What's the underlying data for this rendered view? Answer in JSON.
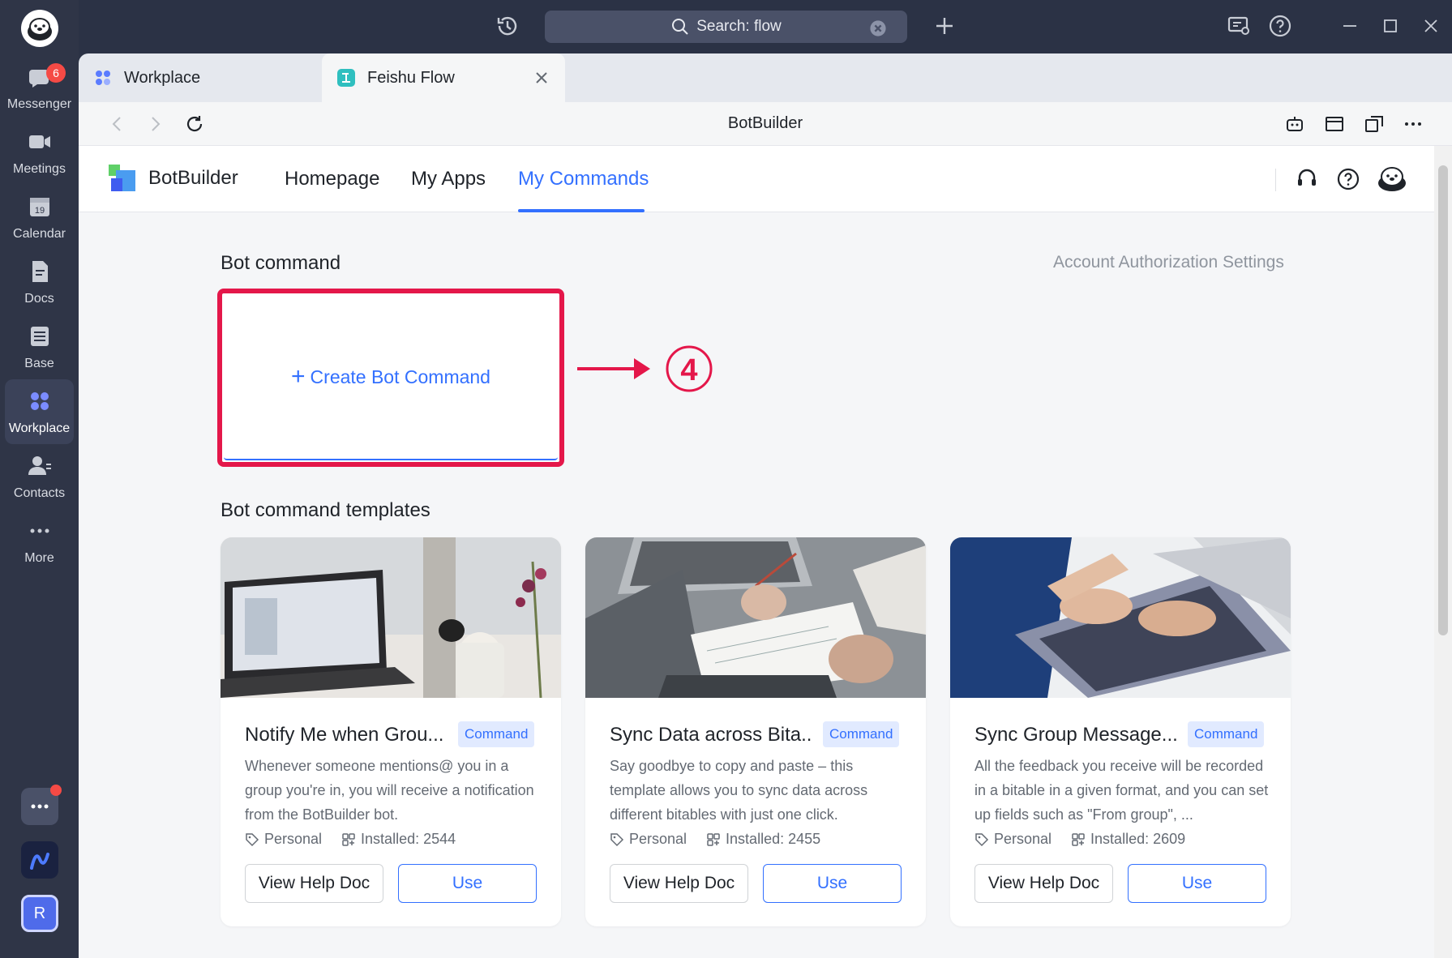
{
  "rail": {
    "messenger_badge": "6",
    "items": [
      {
        "label": "Messenger"
      },
      {
        "label": "Meetings"
      },
      {
        "label": "Calendar",
        "icon_text": "19"
      },
      {
        "label": "Docs"
      },
      {
        "label": "Base"
      },
      {
        "label": "Workplace"
      },
      {
        "label": "Contacts"
      },
      {
        "label": "More"
      }
    ],
    "avatar_letter": "R"
  },
  "topbar": {
    "search_text": "Search: flow"
  },
  "tabs": [
    {
      "label": "Workplace"
    },
    {
      "label": "Feishu Flow"
    }
  ],
  "browser": {
    "title": "BotBuilder"
  },
  "app": {
    "brand": "BotBuilder",
    "nav": [
      {
        "label": "Homepage"
      },
      {
        "label": "My Apps"
      },
      {
        "label": "My Commands"
      }
    ],
    "bot_command_title": "Bot command",
    "auth_link": "Account Authorization Settings",
    "create_label": "Create Bot Command",
    "annotation_number": "4",
    "templates_title": "Bot command templates",
    "templates": [
      {
        "title": "Notify Me when Grou...",
        "tag": "Command",
        "description": "Whenever someone mentions@ you in a group you're in, you will receive a notification from the BotBuilder bot.",
        "category": "Personal",
        "installed": "Installed: 2544",
        "help_label": "View Help Doc",
        "use_label": "Use"
      },
      {
        "title": "Sync Data across Bita...",
        "tag": "Command",
        "description": "Say goodbye to copy and paste – this template allows you to sync data across different bitables with just one click.",
        "category": "Personal",
        "installed": "Installed: 2455",
        "help_label": "View Help Doc",
        "use_label": "Use"
      },
      {
        "title": "Sync Group Message...",
        "tag": "Command",
        "description": "All the feedback you receive will be recorded in a bitable in a given format, and you can set up fields such as \"From group\", ...",
        "category": "Personal",
        "installed": "Installed: 2609",
        "help_label": "View Help Doc",
        "use_label": "Use"
      }
    ]
  },
  "colors": {
    "accent": "#3370ff",
    "annotation_red": "#e4174a",
    "rail_bg": "#2f3547"
  }
}
